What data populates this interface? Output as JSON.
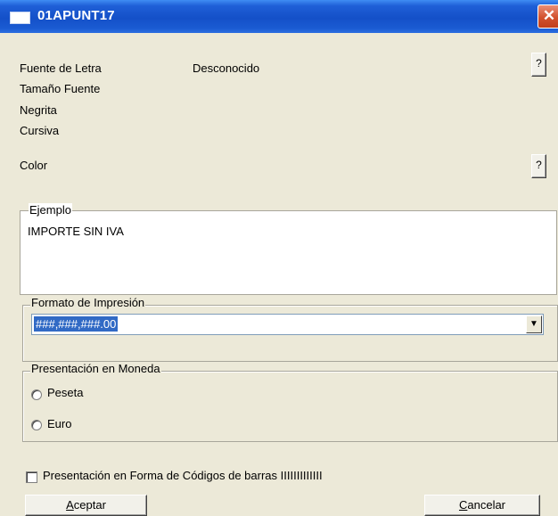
{
  "window": {
    "title": "01APUNT17",
    "close_glyph": "✕"
  },
  "font": {
    "family_label": "Fuente de Letra",
    "family_value": "Desconocido",
    "size_label": "Tamaño Fuente",
    "bold_label": "Negrita",
    "italic_label": "Cursiva",
    "help_glyph": "?"
  },
  "color": {
    "label": "Color",
    "help_glyph": "?"
  },
  "sample": {
    "legend": "Ejemplo",
    "text": "IMPORTE SIN IVA"
  },
  "print_format": {
    "legend": "Formato de Impresión",
    "selected_value": "###,###,###.00",
    "arrow_glyph": "▼"
  },
  "currency": {
    "legend": "Presentación en Moneda",
    "options": [
      "Peseta",
      "Euro"
    ]
  },
  "barcode": {
    "label": "Presentación en Forma de Códigos de barras IIIIIIIIIIIII",
    "checked": false
  },
  "buttons": {
    "ok_hotkey": "A",
    "ok_rest": "ceptar",
    "cancel_hotkey": "C",
    "cancel_rest": "ancelar"
  },
  "colors": {
    "titlebar": "#1450c8",
    "selection": "#316ac5",
    "dialog_bg": "#ece9d8"
  }
}
